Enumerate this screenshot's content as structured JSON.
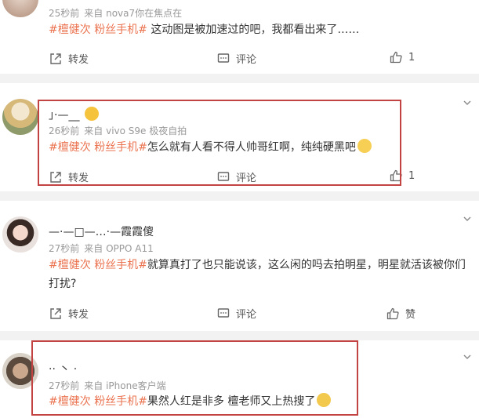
{
  "comments": [
    {
      "time": "25秒前",
      "source": "来自 nova7你在焦点在",
      "tags": [
        "#檀健次",
        "粉丝手机#"
      ],
      "text": "这动图是被加速过的吧，我都看出来了……",
      "repost": "转发",
      "comment": "评论",
      "likes": "1"
    },
    {
      "username": "」·—__",
      "time": "26秒前",
      "source": "来自 vivo S9e 极夜自拍",
      "tags": [
        "#檀健次",
        "粉丝手机#"
      ],
      "text": "怎么就有人看不得人帅哥红啊，纯纯硬黑吧",
      "repost": "转发",
      "comment": "评论",
      "likes": "1"
    },
    {
      "username": "—·—□—…·—霞霞傻",
      "time": "27秒前",
      "source": "来自 OPPO A11",
      "tags": [
        "#檀健次",
        "粉丝手机#"
      ],
      "text": "就算真打了也只能说该，这么闲的吗去拍明星，明星就活该被你们打扰?",
      "repost": "转发",
      "comment": "评论",
      "likes": "赞"
    },
    {
      "username": "·· 丶 ·",
      "time": "27秒前",
      "source": "来自 iPhone客户端",
      "tags": [
        "#檀健次",
        "粉丝手机#"
      ],
      "text": "果然人红是非多 檀老师又上热搜了"
    }
  ],
  "colors": {
    "tag": "#eb7350",
    "highlight_box": "#c34242"
  }
}
